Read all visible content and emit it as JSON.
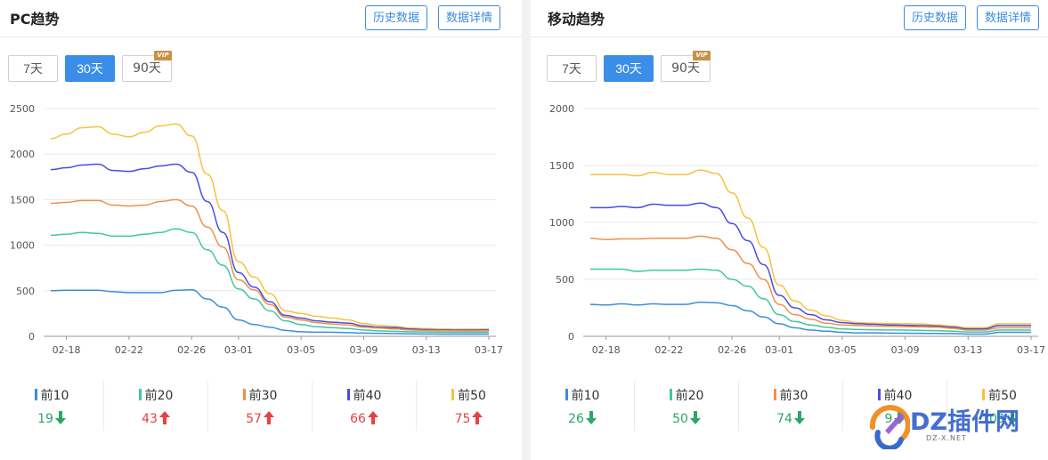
{
  "panels": [
    {
      "id": "pc",
      "title": "PC趋势",
      "buttons": {
        "history": "历史数据",
        "details": "数据详情"
      },
      "ranges": [
        {
          "label": "7天",
          "active": false,
          "vip": false
        },
        {
          "label": "30天",
          "active": true,
          "vip": false
        },
        {
          "label": "90天",
          "active": false,
          "vip": true
        }
      ],
      "vip_label": "VIP",
      "legend": [
        {
          "name": "前10",
          "color": "#3c8dde",
          "value": "19",
          "trend": "down"
        },
        {
          "name": "前20",
          "color": "#3ec9a0",
          "value": "43",
          "trend": "up"
        },
        {
          "name": "前30",
          "color": "#f0904a",
          "value": "57",
          "trend": "up"
        },
        {
          "name": "前40",
          "color": "#4a4de0",
          "value": "66",
          "trend": "up"
        },
        {
          "name": "前50",
          "color": "#f6c23e",
          "value": "75",
          "trend": "up"
        }
      ]
    },
    {
      "id": "mobile",
      "title": "移动趋势",
      "buttons": {
        "history": "历史数据",
        "details": "数据详情"
      },
      "ranges": [
        {
          "label": "7天",
          "active": false,
          "vip": false
        },
        {
          "label": "30天",
          "active": true,
          "vip": false
        },
        {
          "label": "90天",
          "active": false,
          "vip": true
        }
      ],
      "vip_label": "VIP",
      "legend": [
        {
          "name": "前10",
          "color": "#3c8dde",
          "value": "26",
          "trend": "down"
        },
        {
          "name": "前20",
          "color": "#3ec9a0",
          "value": "50",
          "trend": "down"
        },
        {
          "name": "前30",
          "color": "#f0904a",
          "value": "74",
          "trend": "down"
        },
        {
          "name": "前40",
          "color": "#4a4de0",
          "value": "9",
          "trend": "down"
        },
        {
          "name": "前50",
          "color": "#f6c23e",
          "value": "109",
          "trend": "down"
        }
      ]
    }
  ],
  "watermark": {
    "text": "DZ插件网",
    "url": "DZ-X.NET"
  },
  "chart_data": [
    {
      "type": "line",
      "x": [
        "02-17",
        "02-18",
        "02-19",
        "02-20",
        "02-21",
        "02-22",
        "02-23",
        "02-24",
        "02-25",
        "02-26",
        "02-27",
        "02-28",
        "03-01",
        "03-02",
        "03-03",
        "03-04",
        "03-05",
        "03-06",
        "03-07",
        "03-08",
        "03-09",
        "03-10",
        "03-11",
        "03-12",
        "03-13",
        "03-14",
        "03-15",
        "03-16",
        "03-17"
      ],
      "xticks": [
        "02-18",
        "02-22",
        "02-26",
        "03-01",
        "03-05",
        "03-09",
        "03-13",
        "03-17"
      ],
      "ylim": [
        0,
        2500
      ],
      "yticks": [
        0,
        500,
        1000,
        1500,
        2000,
        2500
      ],
      "grid": true,
      "series": [
        {
          "name": "前10",
          "values": [
            500,
            505,
            505,
            505,
            490,
            480,
            480,
            480,
            505,
            510,
            410,
            320,
            180,
            130,
            100,
            65,
            50,
            45,
            45,
            40,
            35,
            33,
            30,
            28,
            26,
            25,
            24,
            24,
            25
          ]
        },
        {
          "name": "前20",
          "values": [
            1110,
            1120,
            1140,
            1130,
            1100,
            1100,
            1120,
            1140,
            1180,
            1140,
            950,
            780,
            520,
            410,
            280,
            170,
            130,
            105,
            95,
            85,
            70,
            60,
            55,
            50,
            48,
            45,
            44,
            44,
            45
          ]
        },
        {
          "name": "前30",
          "values": [
            1460,
            1470,
            1490,
            1490,
            1440,
            1430,
            1440,
            1480,
            1500,
            1430,
            1200,
            980,
            620,
            510,
            350,
            210,
            180,
            150,
            135,
            125,
            100,
            90,
            80,
            70,
            65,
            62,
            60,
            60,
            62
          ]
        },
        {
          "name": "前40",
          "values": [
            1830,
            1850,
            1880,
            1890,
            1820,
            1810,
            1840,
            1870,
            1890,
            1800,
            1480,
            1140,
            700,
            540,
            380,
            230,
            200,
            170,
            155,
            145,
            115,
            100,
            95,
            80,
            75,
            70,
            68,
            68,
            70
          ]
        },
        {
          "name": "前50",
          "values": [
            2170,
            2220,
            2290,
            2300,
            2220,
            2190,
            2240,
            2310,
            2330,
            2200,
            1780,
            1380,
            820,
            650,
            470,
            280,
            250,
            220,
            200,
            180,
            140,
            120,
            110,
            90,
            85,
            80,
            78,
            78,
            80
          ]
        }
      ]
    },
    {
      "type": "line",
      "x": [
        "02-17",
        "02-18",
        "02-19",
        "02-20",
        "02-21",
        "02-22",
        "02-23",
        "02-24",
        "02-25",
        "02-26",
        "02-27",
        "02-28",
        "03-01",
        "03-02",
        "03-03",
        "03-04",
        "03-05",
        "03-06",
        "03-07",
        "03-08",
        "03-09",
        "03-10",
        "03-11",
        "03-12",
        "03-13",
        "03-14",
        "03-15",
        "03-16",
        "03-17"
      ],
      "xticks": [
        "02-18",
        "02-22",
        "02-26",
        "03-01",
        "03-05",
        "03-09",
        "03-13",
        "03-17"
      ],
      "ylim": [
        0,
        2000
      ],
      "yticks": [
        0,
        500,
        1000,
        1500,
        2000
      ],
      "grid": true,
      "series": [
        {
          "name": "前10",
          "values": [
            280,
            275,
            285,
            275,
            285,
            280,
            280,
            300,
            295,
            270,
            225,
            170,
            110,
            75,
            55,
            45,
            35,
            30,
            30,
            28,
            27,
            26,
            25,
            24,
            20,
            20,
            35,
            35,
            35
          ]
        },
        {
          "name": "前20",
          "values": [
            590,
            590,
            590,
            570,
            580,
            580,
            580,
            590,
            580,
            500,
            440,
            330,
            190,
            130,
            100,
            80,
            65,
            60,
            58,
            56,
            55,
            52,
            50,
            45,
            38,
            38,
            55,
            55,
            55
          ]
        },
        {
          "name": "前30",
          "values": [
            860,
            850,
            855,
            855,
            860,
            860,
            860,
            880,
            860,
            760,
            640,
            500,
            280,
            190,
            150,
            115,
            100,
            95,
            90,
            88,
            85,
            83,
            80,
            70,
            55,
            55,
            75,
            75,
            75
          ]
        },
        {
          "name": "前40",
          "values": [
            1130,
            1130,
            1140,
            1130,
            1160,
            1150,
            1150,
            1170,
            1130,
            990,
            840,
            630,
            360,
            250,
            190,
            145,
            120,
            110,
            105,
            100,
            97,
            95,
            90,
            80,
            65,
            65,
            95,
            95,
            95
          ]
        },
        {
          "name": "前50",
          "values": [
            1420,
            1420,
            1420,
            1410,
            1440,
            1420,
            1420,
            1460,
            1430,
            1260,
            1040,
            780,
            450,
            310,
            230,
            180,
            140,
            120,
            115,
            112,
            110,
            108,
            100,
            90,
            75,
            75,
            110,
            110,
            110
          ]
        }
      ]
    }
  ]
}
